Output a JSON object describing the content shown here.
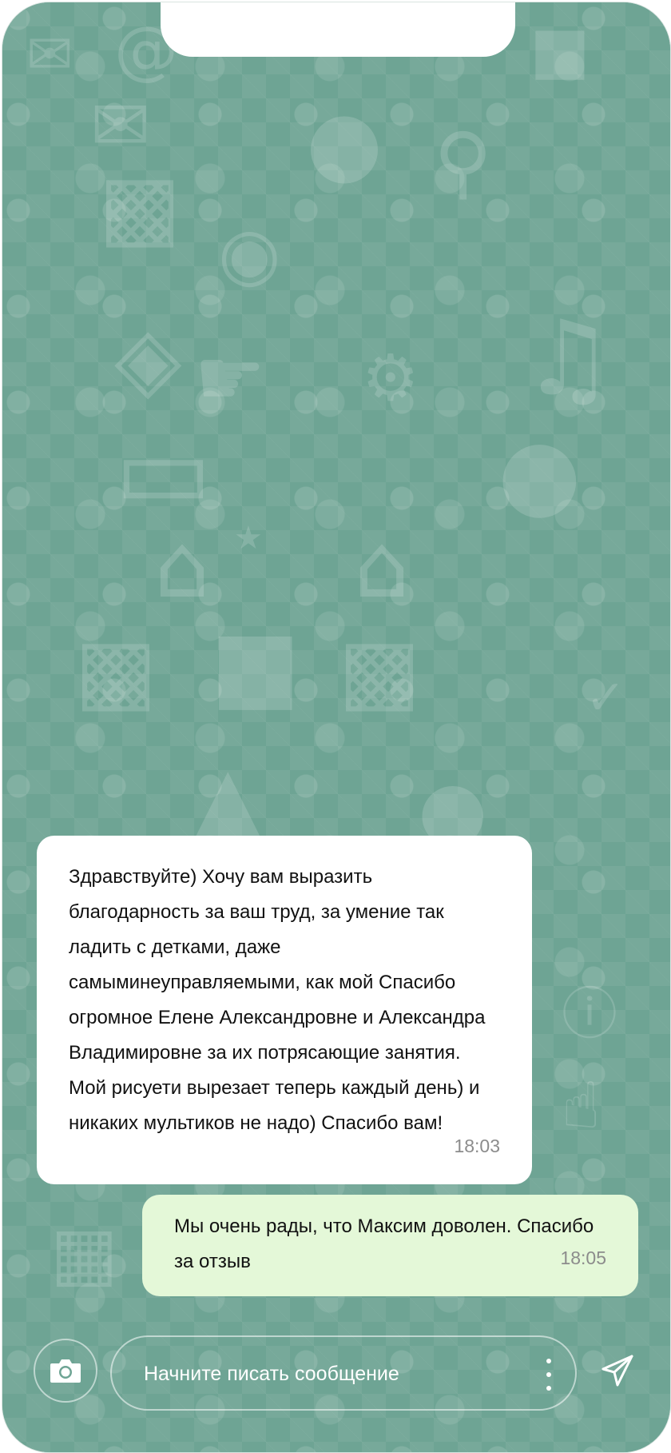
{
  "chat": {
    "messages": [
      {
        "direction": "incoming",
        "text": "Здравствуйте) Хочу вам выразить благодарность за ваш труд, за умение так ладить с детками, даже самыминеуправляемыми, как мой Спасибо огромное Елене Александровне и Александра Владимировне за их потрясающие занятия. Мой рисуети вырезает теперь каждый день) и никаких мультиков не надо) Спасибо вам!",
        "time": "18:03"
      },
      {
        "direction": "outgoing",
        "text": "Мы очень рады, что Максим доволен. Спасибо за отзыв",
        "time": "18:05"
      }
    ]
  },
  "composer": {
    "placeholder": "Начните писать сообщение",
    "camera_icon": "camera-icon",
    "more_icon": "more-vertical-icon",
    "send_icon": "send-icon"
  },
  "colors": {
    "wallpaper": "#6ea494",
    "incoming_bubble": "#ffffff",
    "outgoing_bubble": "#e4f8d8",
    "timestamp": "#8c8c8c"
  }
}
